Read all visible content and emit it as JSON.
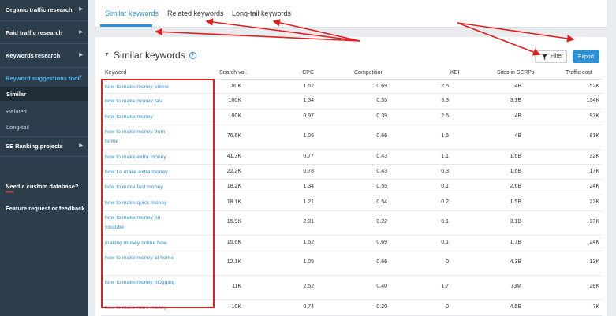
{
  "sidebar": {
    "items": [
      {
        "label": "Organic traffic research"
      },
      {
        "label": "Paid traffic research"
      },
      {
        "label": "Keywords research"
      },
      {
        "label": "Keyword suggestions tool"
      },
      {
        "label": "SE Ranking projects"
      }
    ],
    "subitems": [
      {
        "label": "Similar"
      },
      {
        "label": "Related"
      },
      {
        "label": "Long-tail"
      }
    ],
    "custom_db": "Need a custom database?",
    "new_badge": "NEW",
    "feedback": "Feature request or feedback"
  },
  "tabs": [
    {
      "label": "Similar keywords"
    },
    {
      "label": "Related keywords"
    },
    {
      "label": "Long-tail keywords"
    }
  ],
  "panel": {
    "title": "Similar keywords",
    "filter_label": "Filter",
    "export_label": "Export"
  },
  "table": {
    "headers": [
      "Keyword",
      "Search vol.",
      "CPC",
      "Competition",
      "KEI",
      "Sites in SERPs",
      "Traffic cost"
    ],
    "rows": [
      {
        "keyword": "how to make money online",
        "vol": "100K",
        "cpc": "1.52",
        "comp": "0.69",
        "kei": "2.5",
        "sites": "4B",
        "cost": "152K"
      },
      {
        "keyword": "how to make money fast",
        "vol": "100K",
        "cpc": "1.34",
        "comp": "0.55",
        "kei": "3.3",
        "sites": "3.1B",
        "cost": "134K"
      },
      {
        "keyword": "how to make money",
        "vol": "100K",
        "cpc": "0.97",
        "comp": "0.39",
        "kei": "2.5",
        "sites": "4B",
        "cost": "97K"
      },
      {
        "keyword": "how to make money from home",
        "vol": "76.6K",
        "cpc": "1.06",
        "comp": "0.66",
        "kei": "1.5",
        "sites": "4B",
        "cost": "81K"
      },
      {
        "keyword": "how to make extra money",
        "vol": "41.3K",
        "cpc": "0.77",
        "comp": "0.43",
        "kei": "1.1",
        "sites": "1.6B",
        "cost": "32K"
      },
      {
        "keyword": "how t o make extra money",
        "vol": "22.2K",
        "cpc": "0.78",
        "comp": "0.43",
        "kei": "0.3",
        "sites": "1.6B",
        "cost": "17K"
      },
      {
        "keyword": "how to make fast money",
        "vol": "18.2K",
        "cpc": "1.34",
        "comp": "0.55",
        "kei": "0.1",
        "sites": "2.6B",
        "cost": "24K"
      },
      {
        "keyword": "how to make quick money",
        "vol": "18.1K",
        "cpc": "1.21",
        "comp": "0.54",
        "kei": "0.2",
        "sites": "1.5B",
        "cost": "22K"
      },
      {
        "keyword": "how to make money on youtube",
        "vol": "15.9K",
        "cpc": "2.31",
        "comp": "0.22",
        "kei": "0.1",
        "sites": "3.1B",
        "cost": "37K"
      },
      {
        "keyword": "making money online how",
        "vol": "15.6K",
        "cpc": "1.52",
        "comp": "0.69",
        "kei": "0.1",
        "sites": "1.7B",
        "cost": "24K"
      },
      {
        "keyword": "how to make money at home",
        "vol": "12.1K",
        "cpc": "1.05",
        "comp": "0.66",
        "kei": "0",
        "sites": "4.3B",
        "cost": "13K"
      },
      {
        "keyword": "how to make money blogging",
        "vol": "11K",
        "cpc": "2.52",
        "comp": "0.40",
        "kei": "1.7",
        "sites": "73M",
        "cost": "28K"
      },
      {
        "keyword": "how to make more money",
        "vol": "10K",
        "cpc": "0.74",
        "comp": "0.20",
        "kei": "0",
        "sites": "4.5B",
        "cost": "7K"
      }
    ]
  },
  "colors": {
    "sidebar_bg": "#2c3e4c",
    "accent": "#2d8fd5",
    "annotation": "#e02020"
  }
}
